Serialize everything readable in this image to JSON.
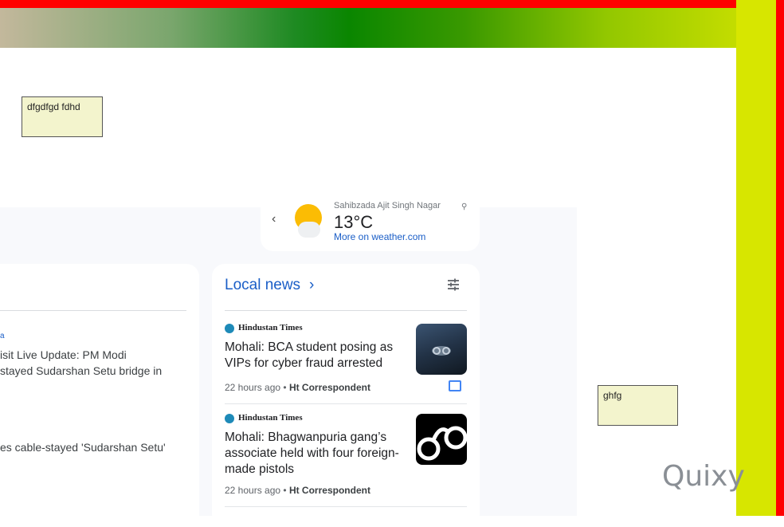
{
  "sticky_notes": {
    "note1": "dfgdfgd fdhd",
    "note2": "ghfg"
  },
  "weather": {
    "location": "Sahibzada Ajit Singh Nagar",
    "temperature": "13°C",
    "link": "More on weather.com",
    "icon": "sun-behind-cloud-icon"
  },
  "left_card": {
    "source_fragment": "a",
    "headline1": "isit Live Update: PM Modi\nstayed Sudarshan Setu bridge in",
    "headline2": "es cable-stayed 'Sudarshan Setu'"
  },
  "local_news": {
    "title": "Local news",
    "items": [
      {
        "source": "Hindustan Times",
        "headline": "Mohali: BCA student posing as VIPs for cyber fraud arrested",
        "time": "22 hours ago",
        "author": "Ht Correspondent"
      },
      {
        "source": "Hindustan Times",
        "headline": "Mohali: Bhagwanpuria gang’s associate held with four foreign-made pistols",
        "time": "22 hours ago",
        "author": "Ht Correspondent"
      }
    ]
  },
  "watermark": "Quixy",
  "colors": {
    "accent_blue": "#1a5ec7",
    "frame_red": "#ff0000",
    "frame_lime": "#d7e600",
    "gradient_green": "#0a8600"
  }
}
